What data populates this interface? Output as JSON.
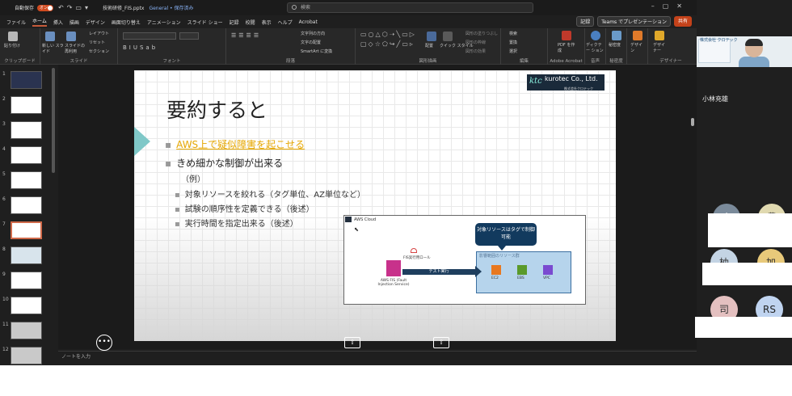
{
  "titlebar": {
    "autosave_label": "自動保存",
    "autosave_state": "オン",
    "filename": "技術研修_FIS.pptx",
    "sensitivity": "General • 保存済み",
    "search_placeholder": "検索"
  },
  "tabs": [
    "ファイル",
    "ホーム",
    "挿入",
    "描画",
    "デザイン",
    "画面切り替え",
    "アニメーション",
    "スライド ショー",
    "記録",
    "校閲",
    "表示",
    "ヘルプ",
    "Acrobat"
  ],
  "active_tab_index": 1,
  "header_buttons": {
    "record": "記録",
    "teams": "Teams でプレゼンテーション",
    "share": "共有"
  },
  "ribbon": {
    "groups": [
      "クリップボード",
      "スライド",
      "フォント",
      "段落",
      "図形描画",
      "編集",
      "Adobe Acrobat",
      "音声",
      "秘密度",
      "デザイナー"
    ],
    "clipboard": {
      "paste": "貼り付け"
    },
    "slides": {
      "new_slide": "新しい スライド",
      "reuse": "スライドの 再利用",
      "layout": "レイアウト",
      "reset": "リセット",
      "section": "セクション"
    },
    "paragraph": {
      "text_direction": "文字列の方向",
      "align_text": "文字の配置",
      "smartart": "SmartArt に変換"
    },
    "drawing": {
      "arrange": "配置",
      "quick_styles": "クイック スタイル",
      "fill": "図形の塗りつぶし",
      "outline": "図形の枠線",
      "effects": "図形の効果"
    },
    "editing": {
      "find": "検索",
      "replace": "置換",
      "select": "選択"
    },
    "acrobat": {
      "pdf": "PDF を作成"
    },
    "voice": {
      "dictate": "ディクテー ション"
    },
    "sensitivity": {
      "label": "秘密度"
    },
    "designer": {
      "design": "デザイ ン",
      "designer": "デザイ ナー"
    }
  },
  "thumbnails": {
    "numbers": [
      "1",
      "2",
      "3",
      "4",
      "5",
      "6",
      "7",
      "8",
      "9",
      "10",
      "11",
      "12"
    ],
    "active_index": 6
  },
  "slide": {
    "logo": "kurotec Co., Ltd.",
    "logo_sub": "株式会社クロテック",
    "title": "要約すると",
    "bullet1": "AWS上で疑似障害を起こせる",
    "bullet2": "きめ細かな制御が出来る",
    "example": "（例）",
    "sub_bullets": [
      "対象リソースを絞れる（タグ単位、AZ単位など）",
      "試験の順序性を定義できる（後述）",
      "実行時間を指定出来る（後述）"
    ],
    "diagram": {
      "cloud_label": "AWS Cloud",
      "callout": "対象リソースはタグで制御可能",
      "target_label": "影響範囲のリソース群",
      "services": [
        "EC2",
        "EBS",
        "VPC"
      ],
      "fis_label": "AWS FIS (Fault Injection Service)",
      "role_label": "FIS実行用ロール",
      "arrow_label": "テスト実行"
    }
  },
  "notes_placeholder": "ノートを入力",
  "meeting": {
    "presenter_name": "小林充雄",
    "video_brand": "株式会社 クロテック",
    "participants": [
      "小",
      "豊",
      "柚",
      "加",
      "司",
      "RS"
    ]
  },
  "colors": {
    "accent": "#c4421a",
    "highlight_text": "#e6a700",
    "callout": "#123a5e"
  }
}
